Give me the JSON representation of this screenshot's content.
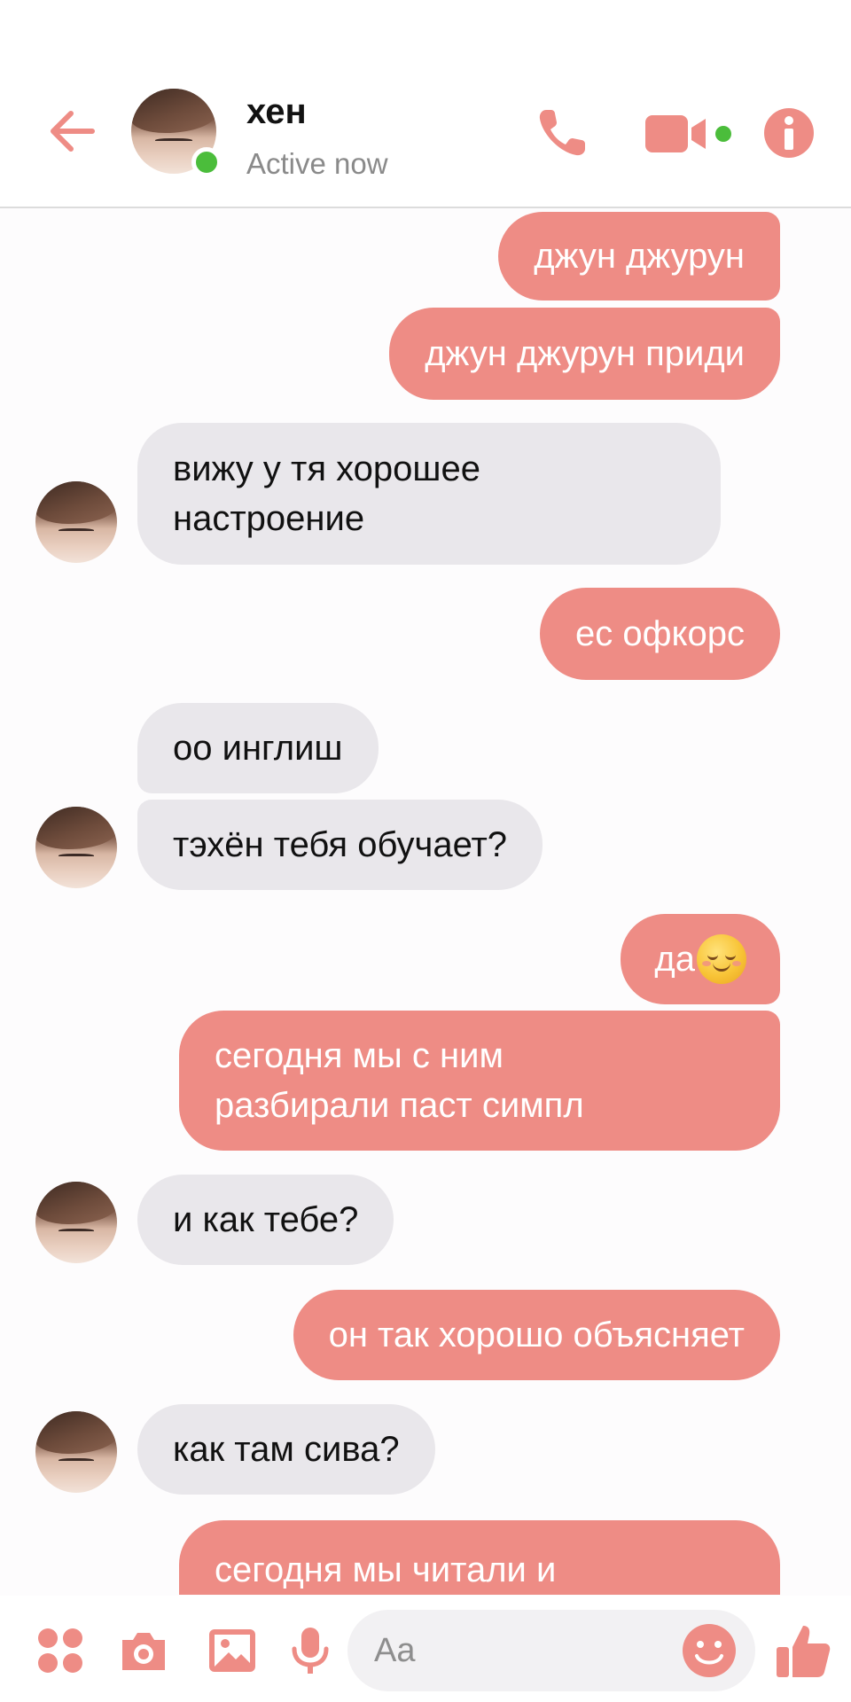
{
  "theme": {
    "accent": "#ee8c85",
    "incoming_bubble": "#e9e7eb",
    "online": "#4bbd3b"
  },
  "header": {
    "back_icon": "arrow-left-icon",
    "contact_name": "хен",
    "status": "Active now",
    "call_icon": "phone-icon",
    "video_icon": "video-camera-icon",
    "info_icon": "info-icon"
  },
  "messages": [
    {
      "direction": "out",
      "text": "джун джурун"
    },
    {
      "direction": "out",
      "text": "джун джурун приди"
    },
    {
      "direction": "in",
      "text": "вижу у тя хорошее\nнастроение"
    },
    {
      "direction": "out",
      "text": "ес офкорс"
    },
    {
      "direction": "in",
      "text": "оо инглиш"
    },
    {
      "direction": "in",
      "text": "тэхён тебя обучает?"
    },
    {
      "direction": "out",
      "text": "да",
      "emoji": "smiling-face-icon"
    },
    {
      "direction": "out",
      "text": "сегодня мы с ним\nразбирали паст симпл"
    },
    {
      "direction": "in",
      "text": "и как тебе?"
    },
    {
      "direction": "out",
      "text": "он так хорошо объясняет"
    },
    {
      "direction": "in",
      "text": "как там сива?"
    },
    {
      "direction": "out",
      "text": "сегодня мы читали и"
    }
  ],
  "composer": {
    "apps_icon": "apps-grid-icon",
    "camera_icon": "camera-icon",
    "gallery_icon": "image-icon",
    "mic_icon": "microphone-icon",
    "placeholder": "Aa",
    "emoji_icon": "smiley-icon",
    "like_icon": "thumbs-up-icon"
  }
}
